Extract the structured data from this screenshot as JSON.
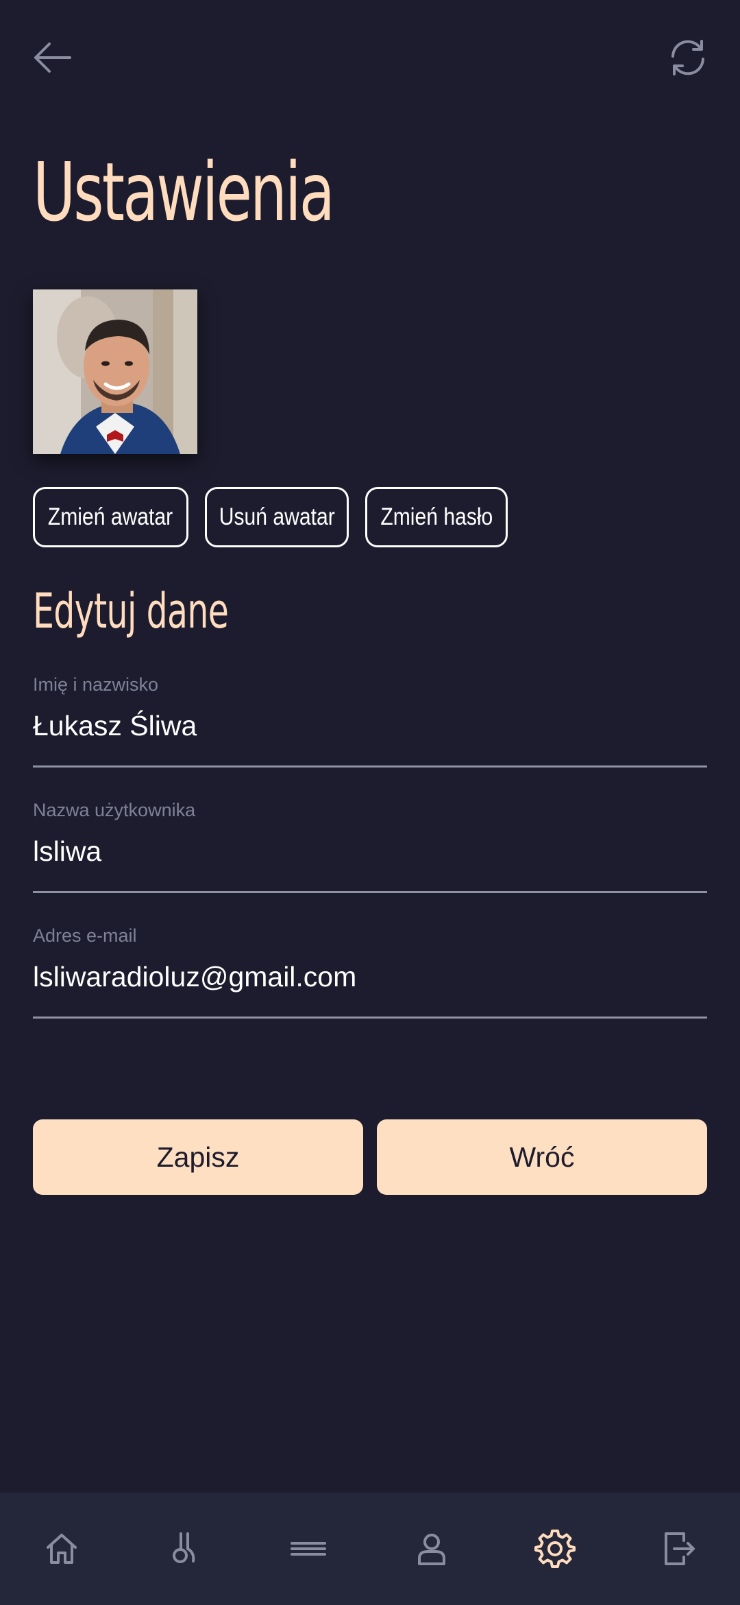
{
  "topbar": {
    "back_icon": "arrow-left-icon",
    "refresh_icon": "refresh-icon"
  },
  "page": {
    "title": "Ustawienia"
  },
  "avatar": {
    "icon": "avatar-photo"
  },
  "avatar_actions": {
    "change_avatar": "Zmień awatar",
    "remove_avatar": "Usuń awatar",
    "change_password": "Zmień hasło"
  },
  "form": {
    "section_title": "Edytuj dane",
    "fields": [
      {
        "label": "Imię i nazwisko",
        "value": "Łukasz Śliwa"
      },
      {
        "label": "Nazwa użytkownika",
        "value": "lsliwa"
      },
      {
        "label": "Adres e-mail",
        "value": "lsliwaradioluz@gmail.com"
      }
    ]
  },
  "actions": {
    "save_label": "Zapisz",
    "back_label": "Wróć"
  },
  "bottom_nav": {
    "items": [
      {
        "icon": "home-icon",
        "active": false
      },
      {
        "icon": "microphone-icon",
        "active": false
      },
      {
        "icon": "menu-icon",
        "active": false
      },
      {
        "icon": "user-icon",
        "active": false
      },
      {
        "icon": "gear-icon",
        "active": true
      },
      {
        "icon": "logout-icon",
        "active": false
      }
    ]
  },
  "colors": {
    "background": "#1c1c2e",
    "accent": "#ffdcbd",
    "button_fill": "#ffdfc1",
    "nav_background": "#24263a",
    "muted": "#7f8196"
  }
}
